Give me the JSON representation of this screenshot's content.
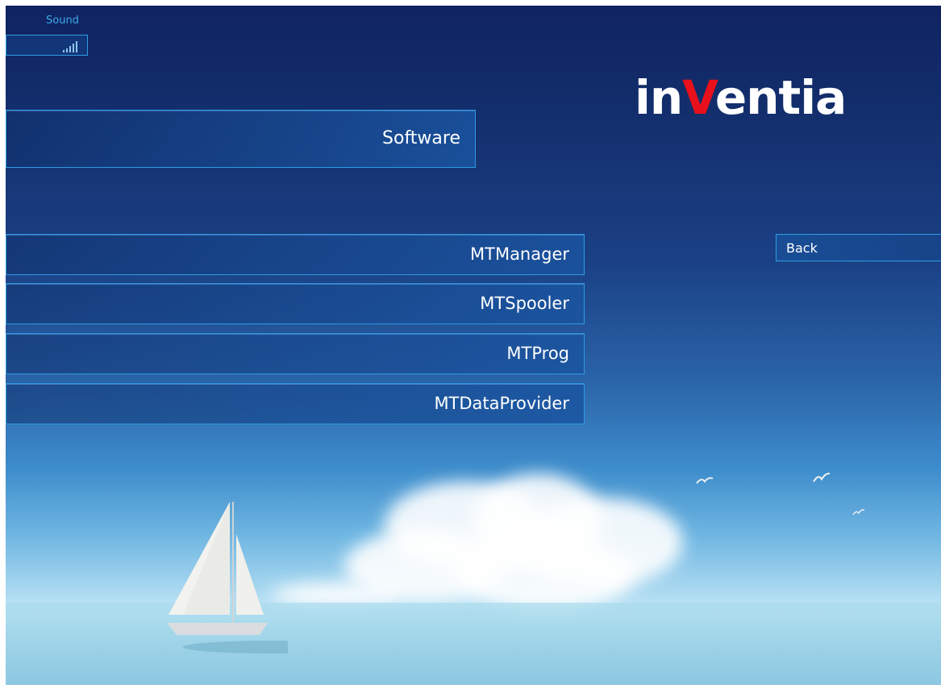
{
  "sound": {
    "label": "Sound",
    "level_bars": 5
  },
  "logo": {
    "text": "inventia",
    "part1": "in",
    "highlight": "V",
    "part2": "entia",
    "highlight_color": "#e8101a"
  },
  "menu": {
    "section_title": "Software",
    "items": [
      {
        "label": "MTManager"
      },
      {
        "label": "MTSpooler"
      },
      {
        "label": "MTProg"
      },
      {
        "label": "MTDataProvider"
      }
    ],
    "back_label": "Back"
  },
  "colors": {
    "border": "#2e9be3",
    "sound_label": "#3ea8f0"
  }
}
